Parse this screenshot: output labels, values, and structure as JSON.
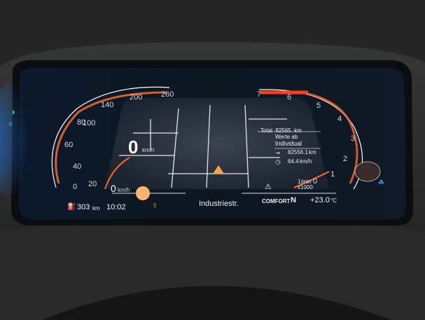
{
  "speedometer": {
    "scale": [
      "0",
      "20",
      "40",
      "60",
      "80",
      "100",
      "140",
      "200",
      "260"
    ],
    "speed_value": "0",
    "speed_unit": "km/h",
    "needle_value": "0",
    "needle_unit": "km/h"
  },
  "tachometer": {
    "scale": [
      "0",
      "1",
      "2",
      "3",
      "4",
      "5",
      "6",
      "7"
    ],
    "unit_line1": "1/min",
    "unit_line2": "x1000",
    "rpm_value": "0"
  },
  "trip": {
    "total_label": "Total",
    "total_value": "82565",
    "total_unit": "km",
    "header_line1": "Werte ab",
    "header_line2": "Individual",
    "distance_value": "82556.1",
    "distance_unit": "km",
    "avg_speed_value": "64.4",
    "avg_speed_unit": "km/h"
  },
  "status_bar": {
    "range_value": "303",
    "range_unit": "km",
    "clock": "10:02",
    "street": "Industriestr.",
    "drive_mode": "COMFORT",
    "gear": "N",
    "temperature": "+23.0",
    "temp_unit": "°C"
  },
  "icons": {
    "left": [
      "headlight-icon",
      "auto-beam-icon"
    ],
    "right": [
      "eco-drive-icon"
    ],
    "bottom": [
      "fuel-pump-icon",
      "seatbelt-warning-icon",
      "hazard-triangle-icon"
    ]
  },
  "colors": {
    "accent_orange": "#ff6a2a",
    "warning_red": "#ff3b1f",
    "cluster_bg": "#0e1620",
    "indicator_green": "#2bd17a",
    "indicator_blue": "#3a9cff"
  }
}
